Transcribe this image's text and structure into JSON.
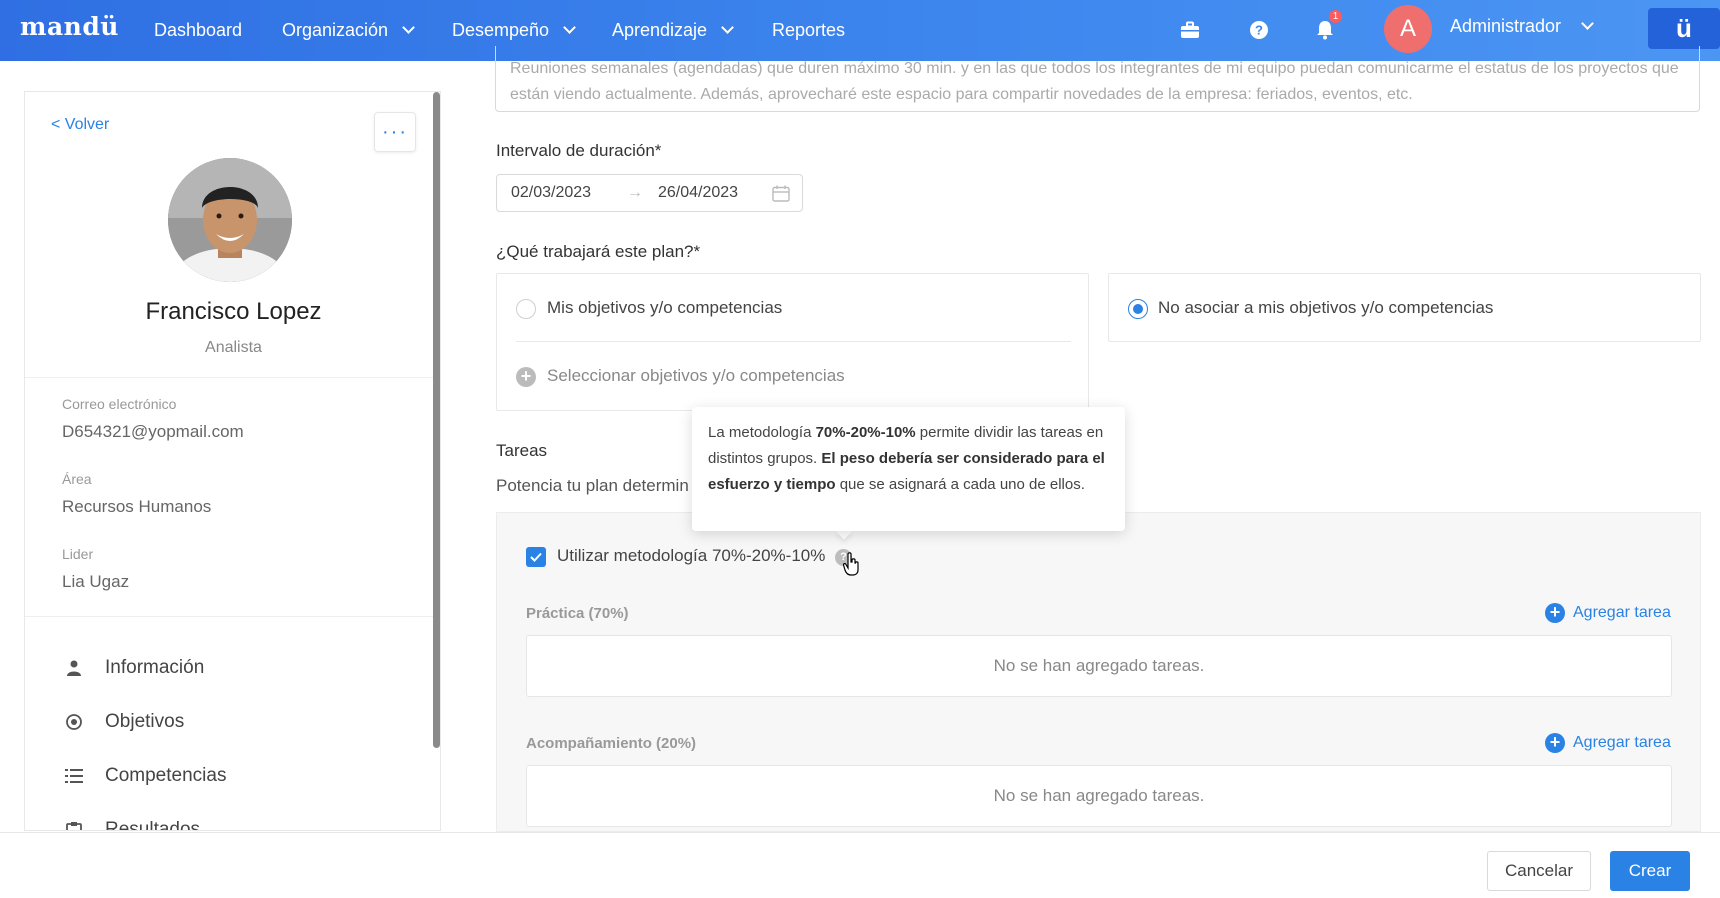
{
  "app": {
    "logo": "mandü"
  },
  "nav": {
    "items": [
      {
        "label": "Dashboard"
      },
      {
        "label": "Organización"
      },
      {
        "label": "Desempeño"
      },
      {
        "label": "Aprendizaje"
      },
      {
        "label": "Reportes"
      }
    ],
    "icons": [
      "briefcase-icon",
      "help-icon",
      "bell-icon"
    ],
    "notification_count": "1",
    "avatar_initial": "A",
    "user_name": "Administrador",
    "app_switch_label": "ü"
  },
  "profile": {
    "back_label": "< Volver",
    "more_label": "···",
    "name": "Francisco Lopez",
    "role": "Analista",
    "fields": [
      {
        "label": "Correo electrónico",
        "value": "D654321@yopmail.com"
      },
      {
        "label": "Área",
        "value": "Recursos Humanos"
      },
      {
        "label": "Lider",
        "value": "Lia Ugaz"
      }
    ],
    "menu": [
      {
        "label": "Información",
        "icon": "user-icon"
      },
      {
        "label": "Objetivos",
        "icon": "target-icon"
      },
      {
        "label": "Competencias",
        "icon": "list-icon"
      },
      {
        "label": "Resultados",
        "icon": "clipboard-icon"
      }
    ]
  },
  "form": {
    "description_text": "Reuniones semanales (agendadas) que duren máximo 30 min. y en las que todos los integrantes de mi equipo puedan comunicarme el estatus de los proyectos que están viendo actualmente. Además, aprovecharé este espacio para compartir novedades de la empresa: feriados, eventos, etc.",
    "duration_label": "Intervalo de duración*",
    "date_start": "02/03/2023",
    "date_arrow": "→",
    "date_end": "26/04/2023",
    "plan_label": "¿Qué trabajará este plan?*",
    "option_mine": "Mis objetivos y/o competencias",
    "option_select": "Seleccionar objetivos y/o competencias",
    "option_none": "No asociar a mis objetivos y/o competencias",
    "option_selected": "none",
    "tasks_label": "Tareas",
    "tasks_desc": "Potencia tu plan determin",
    "use_methodology": "Utilizar metodología 70%-20%-10%",
    "use_methodology_checked": true,
    "groups": [
      {
        "label": "Práctica (70%)",
        "add_label": "Agregar tarea",
        "empty": "No se han agregado tareas."
      },
      {
        "label": "Acompañamiento (20%)",
        "add_label": "Agregar tarea",
        "empty": "No se han agregado tareas."
      }
    ]
  },
  "tooltip": {
    "p1": "La metodología ",
    "b1": "70%-20%-10%",
    "p2": " permite dividir las tareas en distintos grupos. ",
    "b2": "El peso debería ser considerado para el esfuerzo y tiempo",
    "p3": " que se asignará a cada uno de ellos."
  },
  "footer": {
    "cancel_label": "Cancelar",
    "create_label": "Crear"
  },
  "colors": {
    "primary": "#2a82e4",
    "nav_gradient_start": "#2f6fe3",
    "nav_gradient_end": "#4b95f3",
    "avatar": "#ef6f6f"
  }
}
